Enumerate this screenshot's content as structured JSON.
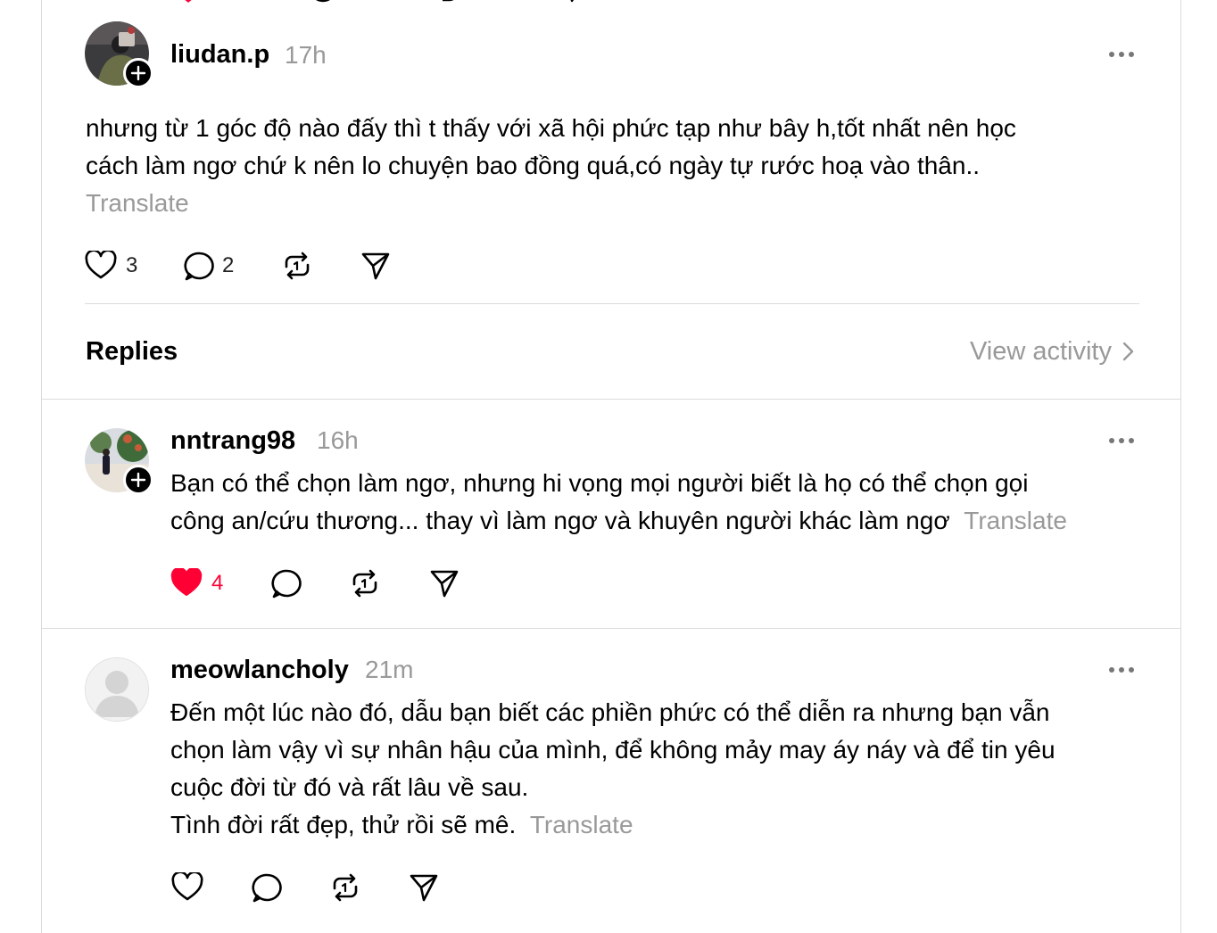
{
  "main_post": {
    "username": "liudan.p",
    "time": "17h",
    "text_line1": "nhưng từ 1 góc độ nào đấy thì t thấy với xã hội phức tạp như bây h,tốt nhất nên học",
    "text_line2": "cách làm ngơ chứ k nên lo chuyện bao đồng quá,có ngày tự rước hoạ vào thân..",
    "translate": "Translate",
    "likes": "3",
    "replies": "2"
  },
  "replies_header": {
    "title": "Replies",
    "view_activity": "View activity"
  },
  "replies": [
    {
      "username": "nntrang98",
      "time": "16h",
      "text_line1": "Bạn có thể chọn làm ngơ, nhưng hi vọng mọi người biết là họ có thể chọn gọi",
      "text_line2": "công an/cứu thương... thay vì làm ngơ và khuyên người khác làm ngơ",
      "translate": "Translate",
      "likes": "4",
      "liked": true
    },
    {
      "username": "meowlancholy",
      "time": "21m",
      "text_line1": "Đến một lúc nào đó, dẫu bạn biết các phiền phức có thể diễn ra nhưng bạn vẫn",
      "text_line2": "chọn làm vậy vì sự nhân hậu của mình, để không mảy may áy náy và để tin yêu",
      "text_line3": "cuộc đời từ đó và rất lâu về sau.",
      "text_line4": "Tình đời rất đẹp, thử rồi sẽ mê.",
      "translate": "Translate"
    }
  ],
  "colors": {
    "liked_red": "#ff0034",
    "muted_text": "#999999",
    "divider": "#dcdcdc"
  },
  "icons": [
    "heart-icon",
    "comment-icon",
    "repost-icon",
    "share-icon",
    "more-icon",
    "follow-plus-icon",
    "chevron-right-icon"
  ]
}
